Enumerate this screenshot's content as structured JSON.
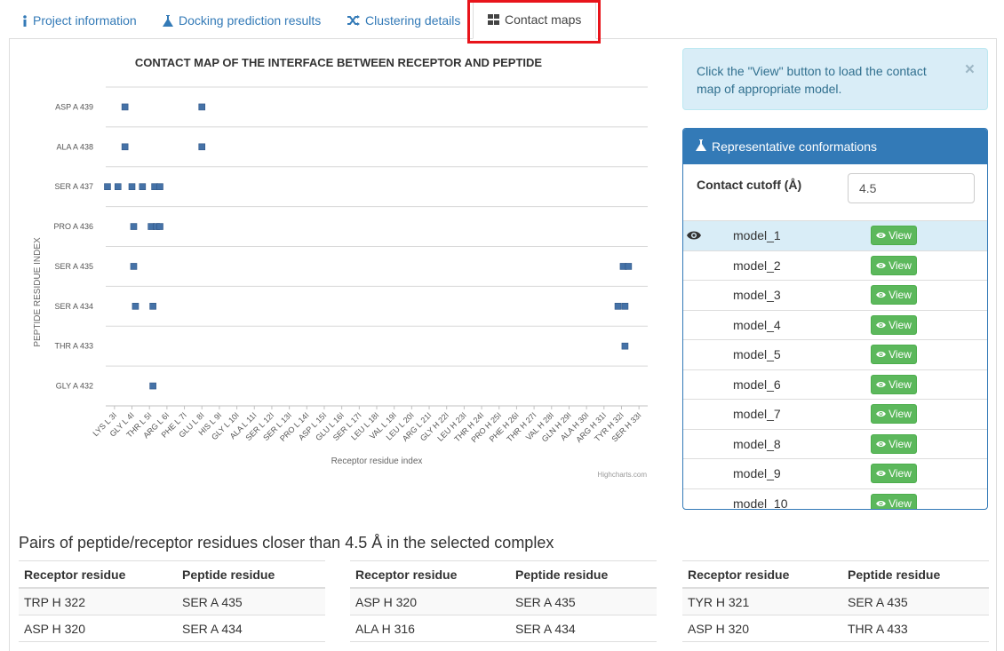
{
  "tabs": [
    {
      "label": "Project information",
      "icon": "info-icon"
    },
    {
      "label": "Docking prediction results",
      "icon": "flask-icon"
    },
    {
      "label": "Clustering details",
      "icon": "random-icon"
    },
    {
      "label": "Contact maps",
      "icon": "grid-icon"
    }
  ],
  "colors": {
    "accent": "#337ab7",
    "marker": "#4572a7",
    "highlight": "#e8141b",
    "view_button": "#5cb85c"
  },
  "chart_data": {
    "type": "scatter",
    "title": "CONTACT MAP OF THE INTERFACE BETWEEN RECEPTOR AND PEPTIDE",
    "xlabel": "Receptor residue index",
    "ylabel": "PEPTIDE RESIDUE INDEX",
    "credit": "Highcharts.com",
    "grid": "horizontal",
    "x_categories": [
      "LYS L 3I",
      "GLY L 4I",
      "THR L 5I",
      "ARG L 6I",
      "PHE L 7I",
      "GLU L 8I",
      "HIS L 9I",
      "GLY L 10I",
      "ALA L 11I",
      "SER L 12I",
      "SER L 13I",
      "PRO L 14I",
      "ASP L 15I",
      "GLU L 16I",
      "SER L 17I",
      "LEU L 18I",
      "VAL L 19I",
      "LEU L 20I",
      "ARG L 21I",
      "GLY H 22I",
      "LEU H 23I",
      "THR H 24I",
      "PRO H 25I",
      "PHE H 26I",
      "THR H 27I",
      "VAL H 28I",
      "GLN H 29I",
      "ALA H 30I",
      "ARG H 31I",
      "TYR H 32I",
      "SER H 33I"
    ],
    "y_categories": [
      "GLY A 432",
      "THR A 433",
      "SER A 434",
      "SER A 435",
      "PRO A 436",
      "SER A 437",
      "ALA A 438",
      "ASP A 439"
    ],
    "points": [
      [
        0.6,
        7
      ],
      [
        5,
        7
      ],
      [
        0.6,
        6
      ],
      [
        5,
        6
      ],
      [
        -0.4,
        5
      ],
      [
        0.2,
        5
      ],
      [
        1,
        5
      ],
      [
        1.6,
        5
      ],
      [
        2.3,
        5
      ],
      [
        2.6,
        5
      ],
      [
        1.1,
        4
      ],
      [
        2.1,
        4
      ],
      [
        2.4,
        4
      ],
      [
        2.6,
        4
      ],
      [
        1.1,
        3
      ],
      [
        29.1,
        3
      ],
      [
        29.4,
        3
      ],
      [
        1.2,
        2
      ],
      [
        2.2,
        2
      ],
      [
        28.8,
        2
      ],
      [
        29.2,
        2
      ],
      [
        29.2,
        1
      ],
      [
        2.2,
        0
      ]
    ]
  },
  "alert": {
    "text": "Click the \"View\" button to load the contact map of appropriate model.",
    "close": "×"
  },
  "rep": {
    "title": "Representative conformations",
    "cutoff_label": "Contact cutoff (Å)",
    "cutoff_value": "4.5",
    "view_label": "View",
    "models": [
      "model_1",
      "model_2",
      "model_3",
      "model_4",
      "model_5",
      "model_6",
      "model_7",
      "model_8",
      "model_9",
      "model_10"
    ]
  },
  "pairs": {
    "title": "Pairs of peptide/receptor residues closer than 4.5 Å in the selected complex",
    "headers": [
      "Receptor residue",
      "Peptide residue"
    ],
    "tables": [
      [
        [
          "TRP H 322",
          "SER A 435"
        ],
        [
          "ASP H 320",
          "SER A 434"
        ]
      ],
      [
        [
          "ASP H 320",
          "SER A 435"
        ],
        [
          "ALA H 316",
          "SER A 434"
        ]
      ],
      [
        [
          "TYR H 321",
          "SER A 435"
        ],
        [
          "ASP H 320",
          "THR A 433"
        ]
      ]
    ]
  }
}
